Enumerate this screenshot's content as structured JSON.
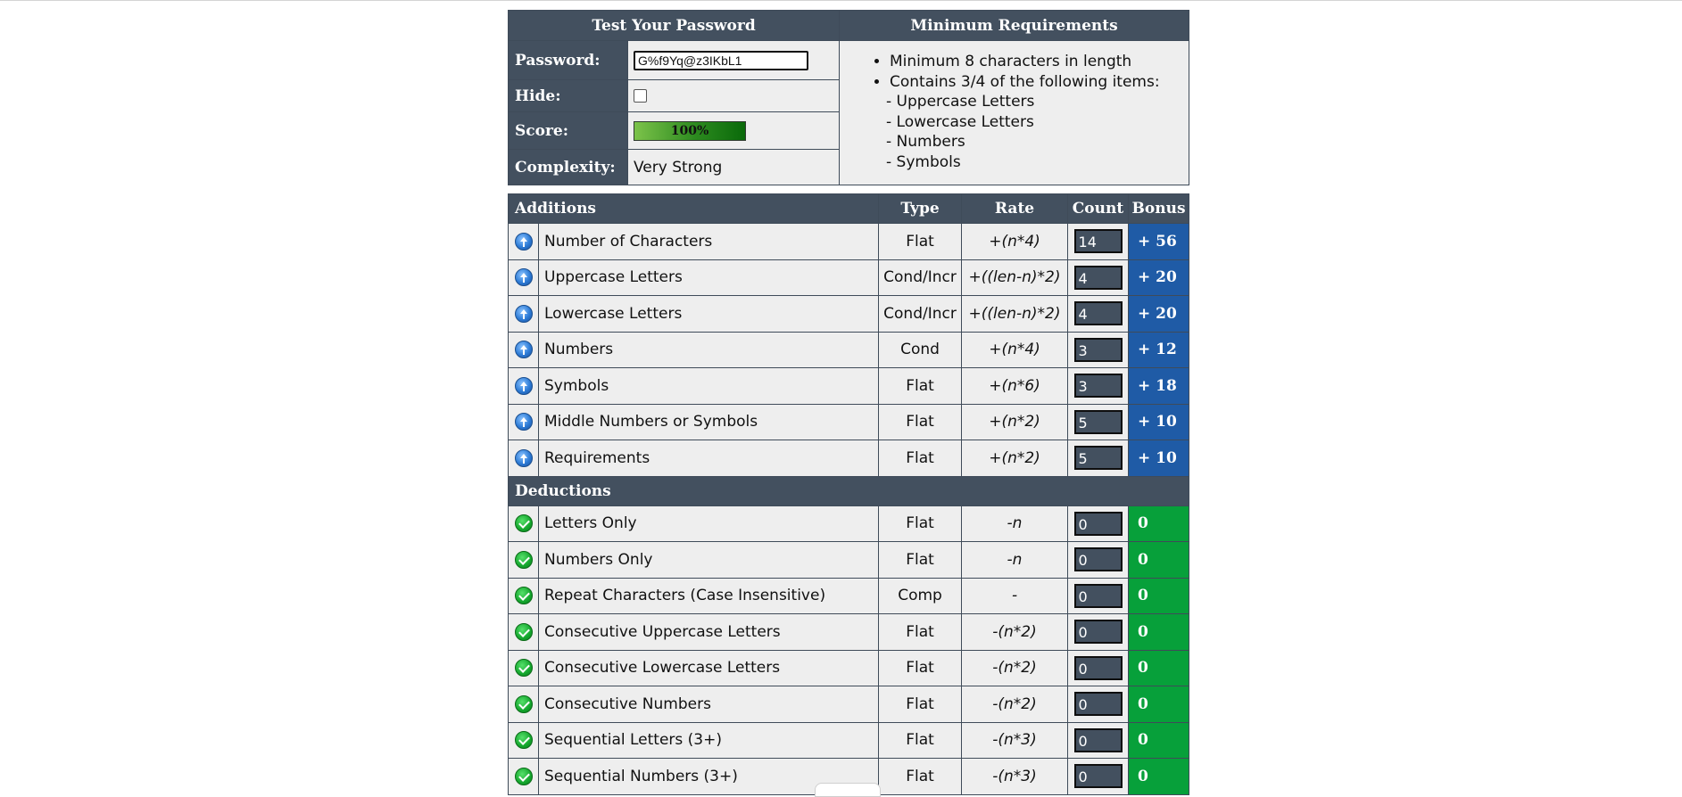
{
  "test": {
    "header": "Test Your Password",
    "password_label": "Password:",
    "password_value": "G%f9Yq@z3IKbL1",
    "hide_label": "Hide:",
    "hide_checked": false,
    "score_label": "Score:",
    "score_text": "100%",
    "score_fraction": 1.0,
    "complexity_label": "Complexity:",
    "complexity_value": "Very Strong"
  },
  "requirements": {
    "header": "Minimum Requirements",
    "items": [
      "Minimum 8 characters in length",
      "Contains 3/4 of the following items:"
    ],
    "subitems": [
      "- Uppercase Letters",
      "- Lowercase Letters",
      "- Numbers",
      "- Symbols"
    ]
  },
  "columns": {
    "additions": "Additions",
    "type": "Type",
    "rate": "Rate",
    "count": "Count",
    "bonus": "Bonus",
    "deductions": "Deductions"
  },
  "additions": [
    {
      "name": "Number of Characters",
      "type": "Flat",
      "rate": "+(n*4)",
      "count": "14",
      "bonus": "+ 56",
      "icon": "arrow-up-icon"
    },
    {
      "name": "Uppercase Letters",
      "type": "Cond/Incr",
      "rate": "+((len-n)*2)",
      "count": "4",
      "bonus": "+ 20",
      "icon": "arrow-up-icon"
    },
    {
      "name": "Lowercase Letters",
      "type": "Cond/Incr",
      "rate": "+((len-n)*2)",
      "count": "4",
      "bonus": "+ 20",
      "icon": "arrow-up-icon"
    },
    {
      "name": "Numbers",
      "type": "Cond",
      "rate": "+(n*4)",
      "count": "3",
      "bonus": "+ 12",
      "icon": "arrow-up-icon"
    },
    {
      "name": "Symbols",
      "type": "Flat",
      "rate": "+(n*6)",
      "count": "3",
      "bonus": "+ 18",
      "icon": "arrow-up-icon"
    },
    {
      "name": "Middle Numbers or Symbols",
      "type": "Flat",
      "rate": "+(n*2)",
      "count": "5",
      "bonus": "+ 10",
      "icon": "arrow-up-icon"
    },
    {
      "name": "Requirements",
      "type": "Flat",
      "rate": "+(n*2)",
      "count": "5",
      "bonus": "+ 10",
      "icon": "arrow-up-icon"
    }
  ],
  "deductions": [
    {
      "name": "Letters Only",
      "type": "Flat",
      "rate": "-n",
      "count": "0",
      "bonus": "0",
      "icon": "checkmark-icon"
    },
    {
      "name": "Numbers Only",
      "type": "Flat",
      "rate": "-n",
      "count": "0",
      "bonus": "0",
      "icon": "checkmark-icon"
    },
    {
      "name": "Repeat Characters (Case Insensitive)",
      "type": "Comp",
      "rate": "-",
      "count": "0",
      "bonus": "0",
      "icon": "checkmark-icon"
    },
    {
      "name": "Consecutive Uppercase Letters",
      "type": "Flat",
      "rate": "-(n*2)",
      "count": "0",
      "bonus": "0",
      "icon": "checkmark-icon"
    },
    {
      "name": "Consecutive Lowercase Letters",
      "type": "Flat",
      "rate": "-(n*2)",
      "count": "0",
      "bonus": "0",
      "icon": "checkmark-icon"
    },
    {
      "name": "Consecutive Numbers",
      "type": "Flat",
      "rate": "-(n*2)",
      "count": "0",
      "bonus": "0",
      "icon": "checkmark-icon"
    },
    {
      "name": "Sequential Letters (3+)",
      "type": "Flat",
      "rate": "-(n*3)",
      "count": "0",
      "bonus": "0",
      "icon": "checkmark-icon"
    },
    {
      "name": "Sequential Numbers (3+)",
      "type": "Flat",
      "rate": "-(n*3)",
      "count": "0",
      "bonus": "0",
      "icon": "checkmark-icon"
    }
  ],
  "colors": {
    "header_bg": "#43505f",
    "cell_bg": "#eeeeee",
    "bonus_addition": "#1f5ba6",
    "bonus_deduction": "#07a03a"
  }
}
